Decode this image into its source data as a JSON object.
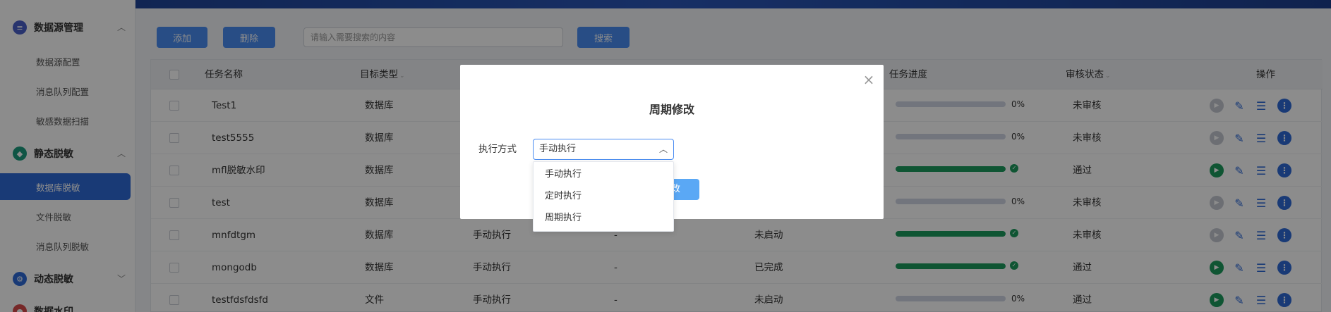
{
  "sidebar": {
    "groups": [
      {
        "label": "数据源管理",
        "icon": "database-icon",
        "color": "#4a5fc8",
        "chevron": "^"
      },
      {
        "label": "静态脱敏",
        "icon": "shield-icon",
        "color": "#1c9b7e",
        "chevron": "^"
      },
      {
        "label": "动态脱敏",
        "icon": "gear-icon",
        "color": "#2f6bd8",
        "chevron": "v"
      },
      {
        "label": "数据水印",
        "icon": "watermark-icon",
        "color": "#d84a4a",
        "chevron": ""
      }
    ],
    "items": {
      "datasource_config": "数据源配置",
      "mq_config": "消息队列配置",
      "sensitive_scan": "敏感数据扫描",
      "db_masking": "数据库脱敏",
      "file_masking": "文件脱敏",
      "mq_masking": "消息队列脱敏"
    }
  },
  "toolbar": {
    "add_label": "添加",
    "delete_label": "删除",
    "search_placeholder": "请输入需要搜索的内容",
    "search_label": "搜索"
  },
  "table": {
    "headers": {
      "name": "任务名称",
      "target_type": "目标类型",
      "progress": "任务进度",
      "audit": "审核状态",
      "actions": "操作"
    },
    "rows": [
      {
        "name": "Test1",
        "type": "数据库",
        "exec": "",
        "cron": "",
        "status": "",
        "progress": 0,
        "progress_text": "0%",
        "audit": "未审核"
      },
      {
        "name": "test5555",
        "type": "数据库",
        "exec": "",
        "cron": "",
        "status": "",
        "progress": 0,
        "progress_text": "0%",
        "audit": "未审核"
      },
      {
        "name": "mfl脱敏水印",
        "type": "数据库",
        "exec": "",
        "cron": "",
        "status": "",
        "progress": 1,
        "progress_text": "",
        "audit": "通过"
      },
      {
        "name": "test",
        "type": "数据库",
        "exec": "",
        "cron": "",
        "status": "",
        "progress": 0,
        "progress_text": "0%",
        "audit": "未审核"
      },
      {
        "name": "mnfdtgm",
        "type": "数据库",
        "exec": "手动执行",
        "cron": "-",
        "status": "未启动",
        "progress": 1,
        "progress_text": "",
        "audit": "未审核"
      },
      {
        "name": "mongodb",
        "type": "数据库",
        "exec": "手动执行",
        "cron": "-",
        "status": "已完成",
        "progress": 1,
        "progress_text": "",
        "audit": "通过"
      },
      {
        "name": "testfdsfdsfd",
        "type": "文件",
        "exec": "手动执行",
        "cron": "-",
        "status": "未启动",
        "progress": 0,
        "progress_text": "0%",
        "audit": "通过"
      }
    ]
  },
  "modal": {
    "title": "周期修改",
    "field_label": "执行方式",
    "selected": "手动执行",
    "options": [
      "手动执行",
      "定时执行",
      "周期执行"
    ],
    "confirm_label": "修改"
  },
  "colors": {
    "accent": "#4a8cf2",
    "success": "#1c9b5e",
    "nav_active": "#2f6bd8"
  }
}
